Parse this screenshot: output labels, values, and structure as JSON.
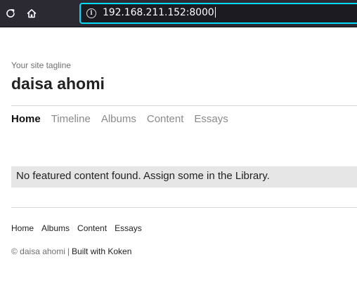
{
  "browser": {
    "url": "192.168.211.152:8000",
    "icons": [
      "reload-icon",
      "home-icon",
      "info-icon"
    ]
  },
  "site": {
    "tagline": "Your site tagline",
    "title": "daisa ahomi"
  },
  "nav": {
    "items": [
      {
        "label": "Home",
        "active": true
      },
      {
        "label": "Timeline"
      },
      {
        "label": "Albums"
      },
      {
        "label": "Content"
      },
      {
        "label": "Essays"
      }
    ]
  },
  "notice": {
    "text": "No featured content found. Assign some in the Library."
  },
  "footer": {
    "links": [
      "Home",
      "Albums",
      "Content",
      "Essays"
    ],
    "copyright": "© daisa ahomi",
    "separator": "|",
    "built_with": "Built with Koken"
  },
  "colors": {
    "toolbar_bg": "#2b2a33",
    "urlbar_focus": "#00ddff",
    "notice_bg": "#e6e6e6"
  }
}
